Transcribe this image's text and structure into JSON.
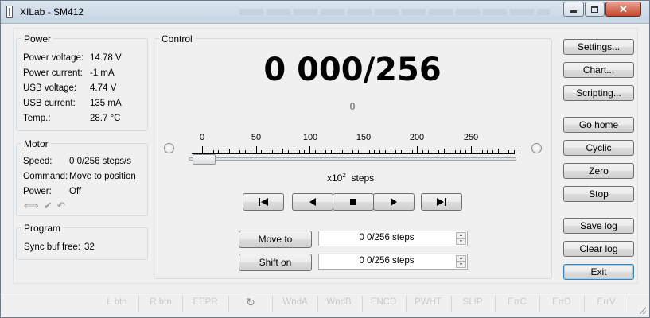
{
  "window": {
    "title": "XILab - SM412"
  },
  "power": {
    "title": "Power",
    "rows": [
      {
        "label": "Power voltage:",
        "value": "14.78 V"
      },
      {
        "label": "Power current:",
        "value": "-1 mA"
      },
      {
        "label": "USB voltage:",
        "value": "4.74 V"
      },
      {
        "label": "USB current:",
        "value": "135 mA"
      },
      {
        "label": "Temp.:",
        "value": "28.7 °C"
      }
    ]
  },
  "motor": {
    "title": "Motor",
    "rows": [
      {
        "label": "Speed:",
        "value": "0 0/256 steps/s"
      },
      {
        "label": "Command:",
        "value": "Move to position"
      },
      {
        "label": "Power:",
        "value": "Off"
      }
    ],
    "icons": [
      "double-arrow-icon",
      "check-icon",
      "undo-icon"
    ]
  },
  "program": {
    "title": "Program",
    "rows": [
      {
        "label": "Sync buf free:",
        "value": "32"
      }
    ]
  },
  "control": {
    "title": "Control",
    "position": "0 000/256",
    "encoder": "0",
    "scale_ticks": [
      "0",
      "50",
      "100",
      "150",
      "200",
      "250"
    ],
    "units_prefix": "x10",
    "units_exp": "2",
    "units_suffix": "steps",
    "slider_value": 0,
    "transport_icons": [
      "skip-left-icon",
      "play-left-icon",
      "stop-icon",
      "play-right-icon",
      "skip-right-icon"
    ],
    "move_to_label": "Move to",
    "move_to_value": "0 0/256 steps",
    "shift_on_label": "Shift on",
    "shift_on_value": "0 0/256 steps"
  },
  "side_buttons": {
    "settings": "Settings...",
    "chart": "Chart...",
    "scripting": "Scripting...",
    "go_home": "Go home",
    "cyclic": "Cyclic",
    "zero": "Zero",
    "stop": "Stop",
    "save_log": "Save log",
    "clear_log": "Clear log",
    "exit": "Exit"
  },
  "status": {
    "items": [
      "L btn",
      "R btn",
      "EEPR",
      "WndA",
      "WndB",
      "ENCD",
      "PWHT",
      "SLIP",
      "ErrC",
      "ErrD",
      "ErrV"
    ],
    "refresh_icon": "refresh-icon"
  }
}
